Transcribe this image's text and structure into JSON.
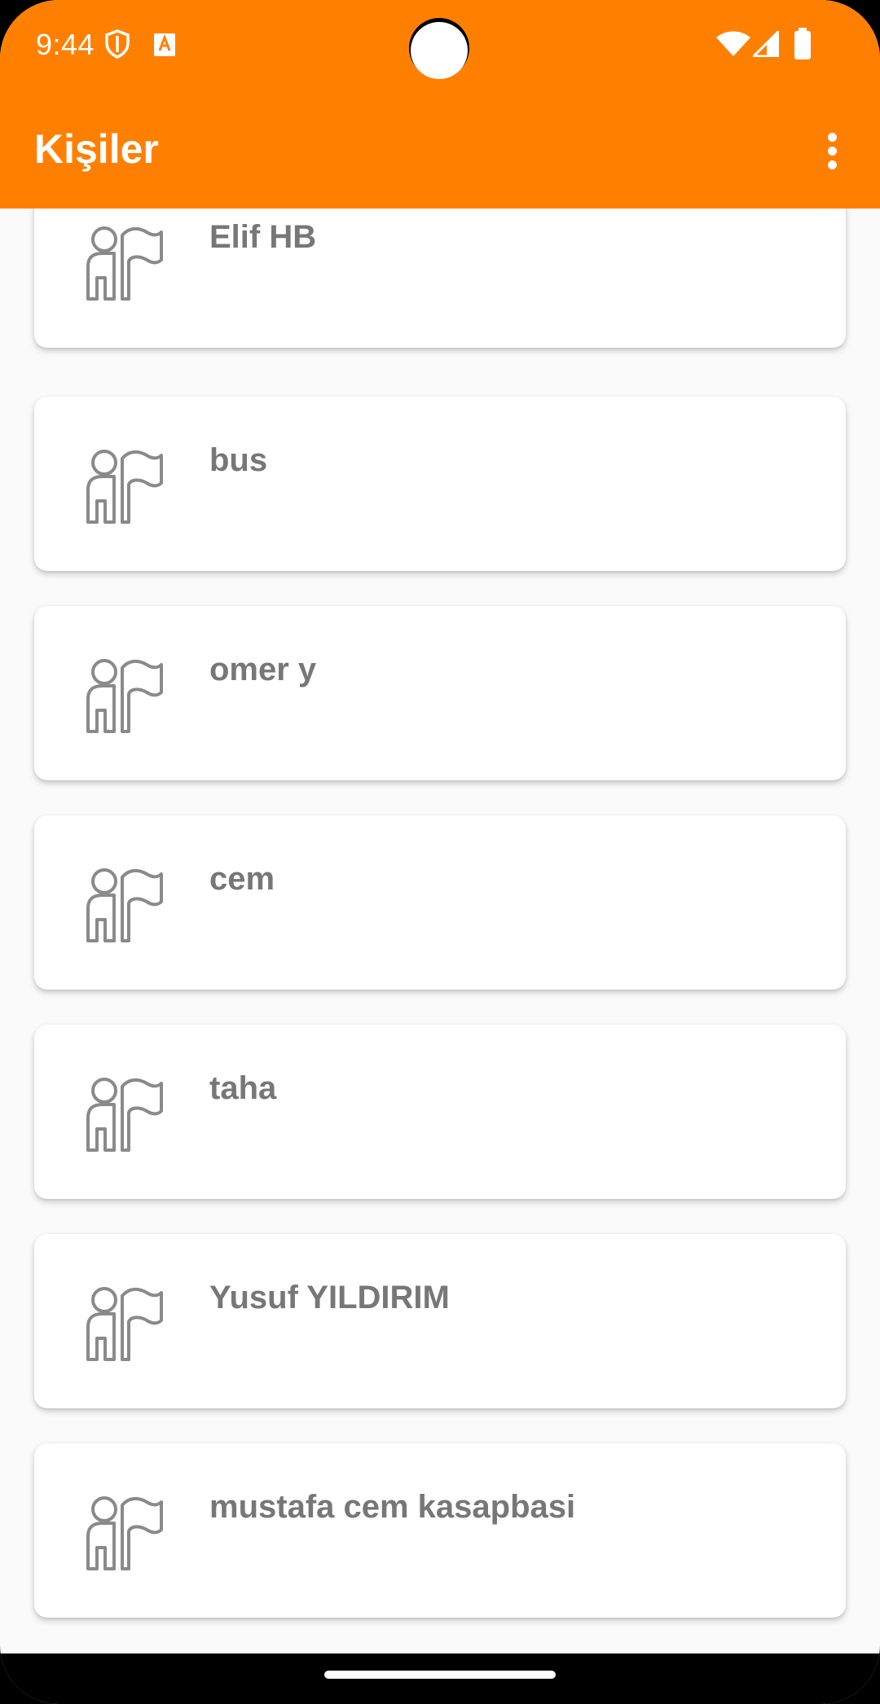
{
  "status_bar": {
    "time": "9:44",
    "icons": [
      "shield-icon",
      "font-badge-icon",
      "wifi-icon",
      "signal-icon",
      "battery-icon"
    ]
  },
  "app_bar": {
    "title": "Kişiler",
    "background": "#FF8000",
    "menu_icon": "more-vertical-icon"
  },
  "contacts": {
    "avatar_icon": "person-with-flag-icon",
    "text_color": "#777777",
    "items": [
      {
        "name": "Elif HB"
      },
      {
        "name": "bus"
      },
      {
        "name": "omer y"
      },
      {
        "name": "cem"
      },
      {
        "name": "taha"
      },
      {
        "name": "Yusuf YILDIRIM"
      },
      {
        "name": "mustafa cem kasapbasi"
      }
    ]
  }
}
